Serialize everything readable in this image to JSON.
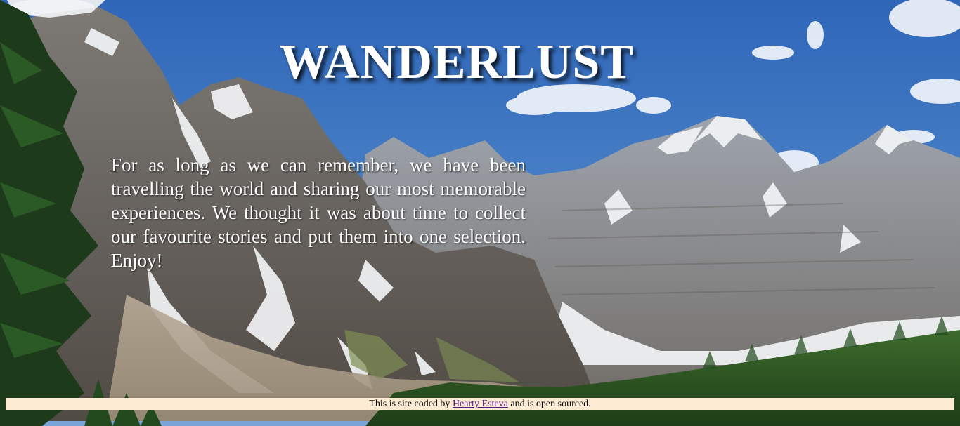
{
  "header": {
    "title": "WANDERLUST"
  },
  "intro": {
    "text": "For as long as we can remember, we have been travelling the world and sharing our most memorable experiences. We thought it was about time to collect our favourite stories and put them into one selection. Enjoy!"
  },
  "footer": {
    "prefix": "This is site coded by ",
    "author_link": "Hearty Esteva",
    "suffix": " and is open sourced."
  },
  "colors": {
    "footer_bg": "#fdebd3",
    "link": "#551a8b",
    "sky": "#3f6fb5"
  }
}
